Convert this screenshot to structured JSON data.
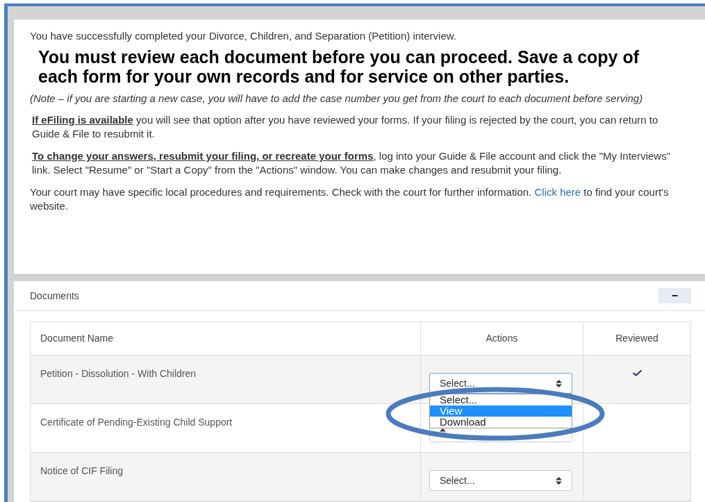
{
  "intro": "You have successfully completed your Divorce, Children, and Separation (Petition) interview.",
  "heading": "You must review each document before you can proceed. Save a copy of each form for your own records and for service on other parties.",
  "note": "(Note – if you are starting a new case, you will have to add the case number you get from the court to each document before serving)",
  "paragraphs": [
    {
      "lead": "If eFiling is available",
      "text": " you will see that option after you have reviewed your forms. If your filing is rejected by the court, you can return to Guide & File to resubmit it."
    },
    {
      "lead": "To change your answers, resubmit your filing, or recreate your forms",
      "text": ", log into your Guide & File account and click the \"My Interviews\" link. Select \"Resume\" or \"Start a Copy\" from the \"Actions\" window. You can make changes and resubmit your filing."
    }
  ],
  "court_note": {
    "text": " Your court may have specific local procedures and requirements. Check with the court for further information. ",
    "link": "Click here",
    "after": " to find your court's website."
  },
  "documents": {
    "title": "Documents",
    "collapse_button": "−",
    "columns": [
      "Document Name",
      "Actions",
      "Reviewed"
    ],
    "rows": [
      {
        "name": "Petition - Dissolution - With Children",
        "select": "Select...",
        "open": true,
        "options": [
          {
            "label": "Select...",
            "selected": false
          },
          {
            "label": "View",
            "selected": true
          },
          {
            "label": "Download",
            "selected": false
          }
        ],
        "reviewed": true
      },
      {
        "name": "Certificate of Pending-Existing Child Support",
        "open": false,
        "reviewed": false
      },
      {
        "name": "Notice of CIF Filing",
        "select": "Select...",
        "open": false,
        "reviewed": false
      }
    ]
  }
}
